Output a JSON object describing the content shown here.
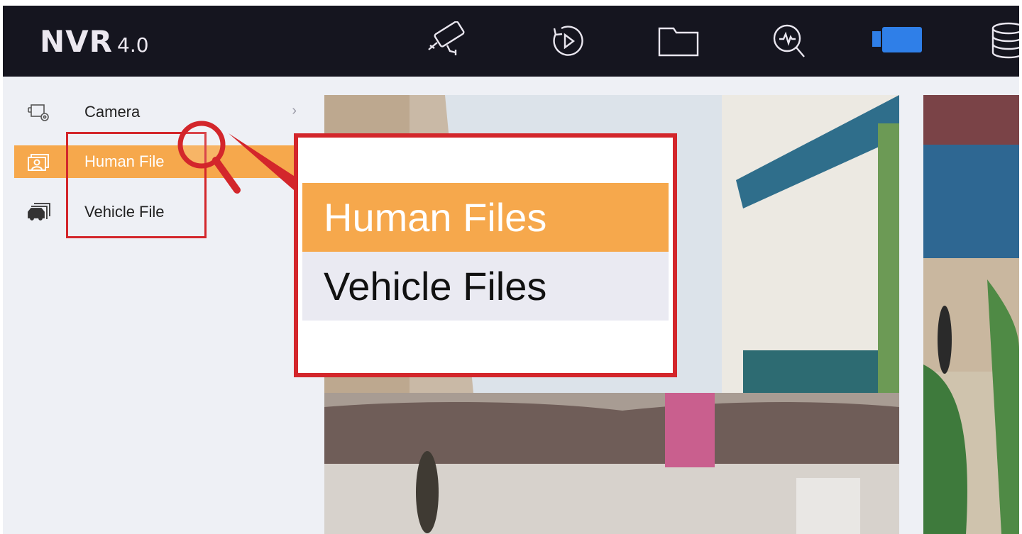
{
  "app": {
    "logo_main": "NVR",
    "logo_version": "4.0"
  },
  "nav_icons": [
    {
      "name": "camera-live-icon"
    },
    {
      "name": "playback-icon"
    },
    {
      "name": "folder-icon"
    },
    {
      "name": "smart-search-icon"
    },
    {
      "name": "video-camera-icon",
      "active": true
    },
    {
      "name": "storage-icon"
    }
  ],
  "sidebar": {
    "items": [
      {
        "label": "Camera",
        "icon": "camera-settings-icon",
        "has_chevron": true,
        "chevron": "›"
      },
      {
        "label": "Human File",
        "icon": "human-file-icon",
        "active": true
      },
      {
        "label": "Vehicle File",
        "icon": "vehicle-file-icon"
      }
    ]
  },
  "callout": {
    "item1": "Human Files",
    "item2": "Vehicle Files"
  },
  "colors": {
    "accent_orange": "#f6a84c",
    "highlight_red": "#d3262b",
    "topbar_bg": "#15151f",
    "active_icon_blue": "#2f7fe8"
  }
}
